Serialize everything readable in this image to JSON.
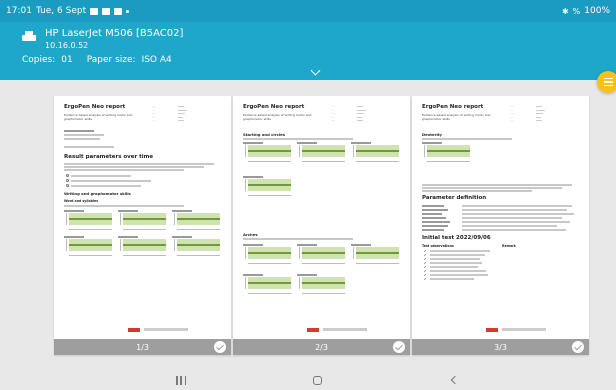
{
  "status_bar": {
    "time": "17:01",
    "date": "Tue, 6 Sept",
    "battery": "100%"
  },
  "printer": {
    "name": "HP LaserJet M506 [B5AC02]",
    "ip": "10.16.0.52",
    "copies_label": "Copies:",
    "copies_value": "01",
    "paper_label": "Paper size:",
    "paper_value": "ISO A4"
  },
  "pages": [
    {
      "footer": "1/3",
      "title": "ErgoPen Neo report",
      "subtitle": "Evidence based analysis of writing motor and graphomotor skills",
      "section1": "Result parameters over time",
      "section2": "Writing and graphomotor skills",
      "section2_sub": "Word and syllables"
    },
    {
      "footer": "2/3",
      "title": "ErgoPen Neo report",
      "subtitle": "Evidence based analysis of writing motor and graphomotor skills",
      "section1": "Starting and circles",
      "section2": "Arches"
    },
    {
      "footer": "3/3",
      "title": "ErgoPen Neo report",
      "subtitle": "Evidence based analysis of writing motor and graphomotor skills",
      "section1": "Dexterity",
      "section2": "Parameter definition",
      "section3": "Initial test 2022/09/06",
      "section3_sub_a": "Test observations",
      "section3_sub_b": "Remark"
    }
  ],
  "colors": {
    "status_bar": "#1a9bbf",
    "header": "#1ea7c9",
    "fab": "#f7c11a",
    "page_footer": "#9e9e9e",
    "chart_band": "#cfe2b0"
  },
  "icons": [
    "printer-icon",
    "chevron-down-icon",
    "menu-icon",
    "check-circle-icon",
    "recent-apps-icon",
    "home-icon",
    "back-icon"
  ]
}
